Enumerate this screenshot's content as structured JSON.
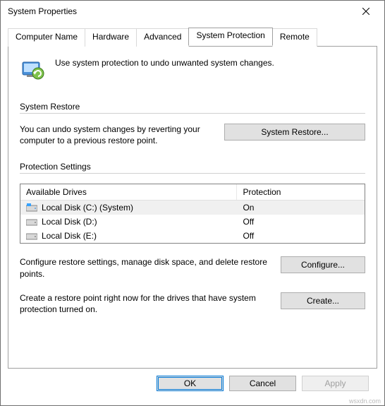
{
  "window": {
    "title": "System Properties"
  },
  "tabs": {
    "t0": "Computer Name",
    "t1": "Hardware",
    "t2": "Advanced",
    "t3": "System Protection",
    "t4": "Remote",
    "active": "t3"
  },
  "intro": "Use system protection to undo unwanted system changes.",
  "restore_group": {
    "title": "System Restore",
    "desc": "You can undo system changes by reverting your computer to a previous restore point.",
    "button": "System Restore..."
  },
  "protection_group": {
    "title": "Protection Settings",
    "col_drives": "Available Drives",
    "col_protection": "Protection",
    "rows": [
      {
        "name": "Local Disk (C:) (System)",
        "protection": "On",
        "selected": true
      },
      {
        "name": "Local Disk (D:)",
        "protection": "Off",
        "selected": false
      },
      {
        "name": "Local Disk (E:)",
        "protection": "Off",
        "selected": false
      }
    ],
    "configure_desc": "Configure restore settings, manage disk space, and delete restore points.",
    "configure_btn": "Configure...",
    "create_desc": "Create a restore point right now for the drives that have system protection turned on.",
    "create_btn": "Create..."
  },
  "footer": {
    "ok": "OK",
    "cancel": "Cancel",
    "apply": "Apply"
  },
  "attrib": "wsxdn.com"
}
